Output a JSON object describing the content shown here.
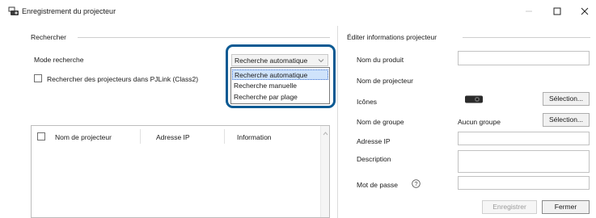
{
  "window": {
    "title": "Enregistrement du projecteur"
  },
  "search": {
    "group_label": "Rechercher",
    "mode_label": "Mode recherche",
    "mode_selected": "Recherche automatique",
    "mode_options": [
      "Recherche automatique",
      "Recherche manuelle",
      "Recherche par plage"
    ],
    "pjlink_label": "Rechercher des projecteurs dans PJLink (Class2)",
    "pjlink_checked": false
  },
  "results_table": {
    "columns": [
      "Nom de projecteur",
      "Adresse IP",
      "Information"
    ],
    "rows": []
  },
  "edit": {
    "group_label": "Éditer informations projecteur",
    "product_name_label": "Nom du produit",
    "product_name_value": "",
    "projector_name_label": "Nom de projecteur",
    "icons_label": "Icônes",
    "icons_button": "Sélection...",
    "group_name_label": "Nom de groupe",
    "group_name_value": "Aucun groupe",
    "group_button": "Sélection...",
    "ip_label": "Adresse IP",
    "ip_value": "",
    "description_label": "Description",
    "description_value": "",
    "password_label": "Mot de passe",
    "password_help": "?",
    "password_value": ""
  },
  "footer": {
    "save_label": "Enregistrer",
    "close_label": "Fermer"
  },
  "colors": {
    "highlight_ring": "#0c5a93",
    "selected_item_bg": "#cfe3fb"
  },
  "icons": {
    "app": "projector-register-icon",
    "dropdown": "chevron-down-icon",
    "projector": "projector-icon",
    "help": "help-circle-icon"
  }
}
